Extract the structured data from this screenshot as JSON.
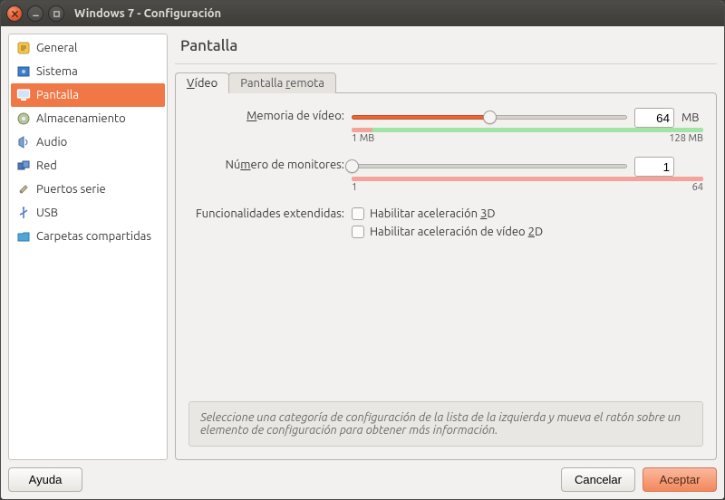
{
  "window": {
    "title": "Windows 7 - Configuración"
  },
  "sidebar": {
    "items": [
      {
        "label": "General"
      },
      {
        "label": "Sistema"
      },
      {
        "label": "Pantalla"
      },
      {
        "label": "Almacenamiento"
      },
      {
        "label": "Audio"
      },
      {
        "label": "Red"
      },
      {
        "label": "Puertos serie"
      },
      {
        "label": "USB"
      },
      {
        "label": "Carpetas compartidas"
      }
    ],
    "selected_index": 2
  },
  "content": {
    "title": "Pantalla",
    "tabs": [
      {
        "label": "Vídeo",
        "mnemonic_index": 0
      },
      {
        "label": "Pantalla remota",
        "mnemonic_index": 9
      }
    ],
    "active_tab": 0,
    "video": {
      "memory_label": "Memoria de vídeo:",
      "memory_mnemonic": "M",
      "memory_value": 64,
      "memory_unit": "MB",
      "memory_min": "1 MB",
      "memory_max": "128 MB",
      "memory_fill_pct": 50,
      "memory_quality": [
        {
          "class": "q-red",
          "pct": 6
        },
        {
          "class": "q-green",
          "pct": 94
        }
      ],
      "monitors_label": "Número de monitores:",
      "monitors_mnemonic": "m",
      "monitors_value": 1,
      "monitors_min": "1",
      "monitors_max": "64",
      "monitors_fill_pct": 0,
      "monitors_quality": [
        {
          "class": "q-red",
          "pct": 100
        }
      ],
      "ext_label": "Funcionalidades extendidas:",
      "accel3d_label": "Habilitar aceleración 3D",
      "accel3d_mnemonic": "3",
      "accel3d_checked": false,
      "accel2d_label": "Habilitar aceleración de vídeo 2D",
      "accel2d_mnemonic": "2",
      "accel2d_checked": false
    },
    "hint": "Seleccione una categoría de configuración de la lista de la izquierda y mueva el ratón sobre un elemento de configuración para obtener más información."
  },
  "footer": {
    "help": "Ayuda",
    "cancel": "Cancelar",
    "accept": "Aceptar"
  },
  "icons": {
    "general": "#f0c040",
    "sistema": "#3d7cc9",
    "pantalla": "#ffffff",
    "almacen": "#9aa47b",
    "audio": "#7aa3d4",
    "red": "#4c79b9",
    "puertos": "#b3aa90",
    "usb": "#5a7cc4",
    "carpetas": "#4fa6d9"
  }
}
